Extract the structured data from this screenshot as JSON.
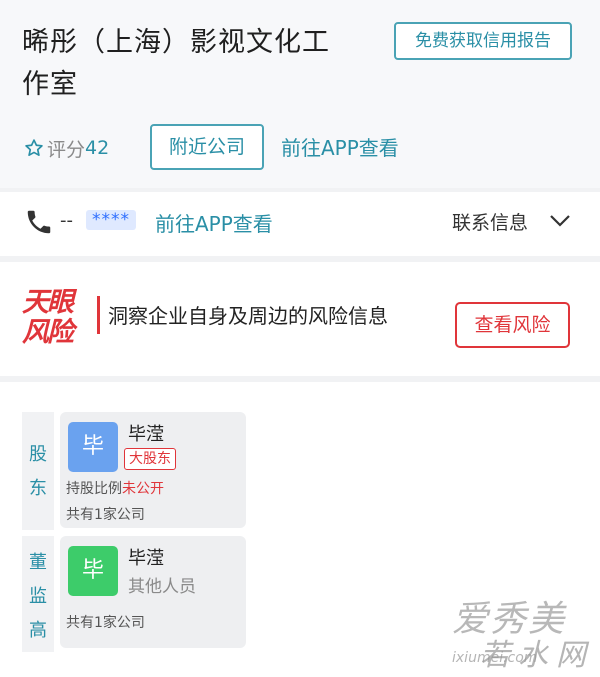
{
  "header": {
    "company_name": "晞彤（上海）影视文化工作室",
    "credit_report_button": "免费获取信用报告",
    "rating_label": "评分",
    "rating_value": "42",
    "nearby_button": "附近公司",
    "app_link": "前往APP查看"
  },
  "contact": {
    "phone_dash": "--",
    "phone_masked": "****",
    "app_link": "前往APP查看",
    "info_label": "联系信息"
  },
  "risk": {
    "logo_line1": "天眼",
    "logo_line2": "风险",
    "description": "洞察企业自身及周边的风险信息",
    "button": "查看风险"
  },
  "shareholders": {
    "tab_chars": [
      "股",
      "东"
    ],
    "person": {
      "avatar_char": "毕",
      "name": "毕滢",
      "tag": "大股东",
      "share_label": "持股比例",
      "share_value": "未公开",
      "company_count": "共有1家公司"
    }
  },
  "directors": {
    "tab_chars": [
      "董",
      "监",
      "高"
    ],
    "person": {
      "avatar_char": "毕",
      "name": "毕滢",
      "role": "其他人员",
      "company_count": "共有1家公司"
    }
  },
  "watermark": {
    "line1": "爱秀美",
    "line2": "若水网",
    "url": "ixiumei.com"
  },
  "colors": {
    "accent": "#2a8fa6",
    "risk_red": "#e0353a",
    "avatar_blue": "#6aa2ef",
    "avatar_green": "#3dcc6a"
  }
}
